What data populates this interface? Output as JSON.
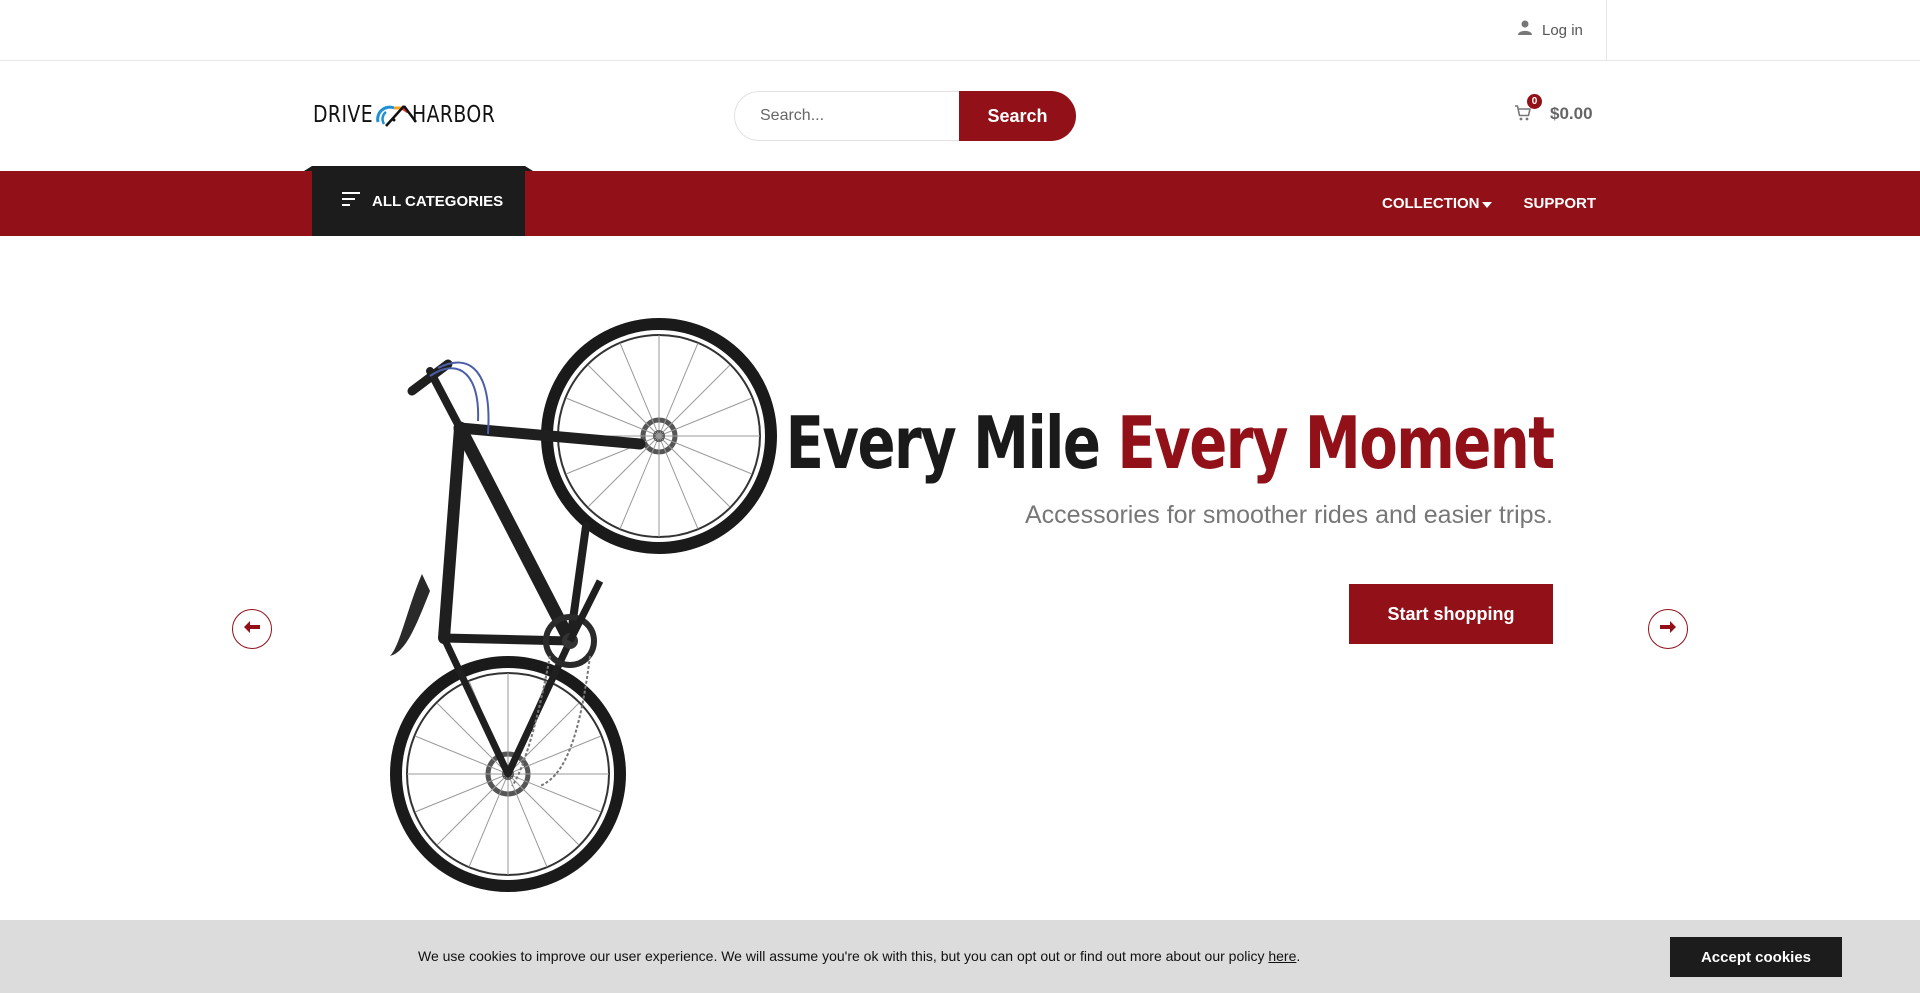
{
  "topbar": {
    "login_label": "Log in",
    "login_icon": "user-icon"
  },
  "header": {
    "logo_left": "DRIVE",
    "logo_right": "HARBOR",
    "search_placeholder": "Search...",
    "search_button": "Search",
    "cart_count": "0",
    "cart_total": "$0.00",
    "cart_icon": "cart-icon"
  },
  "nav": {
    "all_categories": "ALL CATEGORIES",
    "links": [
      "COLLECTION",
      "SUPPORT"
    ]
  },
  "hero": {
    "headline_dark": "Every Mile",
    "headline_red": "Every Moment",
    "subtitle": "Accessories for smoother rides and easier trips.",
    "cta": "Start shopping",
    "prev_icon": "arrow-left-icon",
    "next_icon": "arrow-right-icon",
    "image": "bicycle"
  },
  "cookie": {
    "message": "We use cookies to improve our user experience. We will assume you're ok with this, but you can opt out or find out more about our policy ",
    "link": "here",
    "suffix": ".",
    "accept": "Accept cookies"
  },
  "colors": {
    "brand": "#921118",
    "dark": "#1c1c1c",
    "cookie_bg": "#dcdcdc"
  }
}
